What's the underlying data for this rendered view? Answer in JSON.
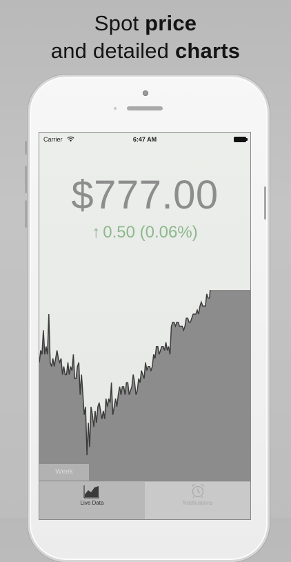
{
  "headline": {
    "line1_prefix": "Spot ",
    "line1_bold": "price",
    "line2_prefix": "and detailed ",
    "line2_bold": "charts"
  },
  "status_bar": {
    "carrier": "Carrier",
    "time": "6:47 AM"
  },
  "price": {
    "value": "$777.00",
    "change": "0.50 (0.06%)",
    "direction_icon": "up-arrow-icon",
    "change_color": "#8cb88c"
  },
  "chart_range_tab": "Week",
  "tab_bar": {
    "tabs": [
      {
        "label": "Live Data",
        "icon": "chart-icon",
        "active": true
      },
      {
        "label": "Notifications",
        "icon": "alarm-clock-icon",
        "active": false
      }
    ]
  },
  "chart_data": {
    "type": "area",
    "y": [
      738,
      741,
      740,
      746,
      740,
      742,
      740,
      750,
      738,
      737,
      739,
      737,
      739,
      741,
      739,
      738,
      739,
      735,
      737,
      735,
      735,
      738,
      735,
      737,
      736,
      740,
      734,
      734,
      737,
      738,
      730,
      735,
      730,
      725,
      727,
      715,
      723,
      717,
      727,
      725,
      722,
      726,
      723,
      727,
      728,
      726,
      724,
      726,
      724,
      729,
      727,
      729,
      728,
      733,
      725,
      727,
      729,
      727,
      730,
      732,
      730,
      732,
      732,
      730,
      733,
      733,
      730,
      731,
      732,
      735,
      733,
      730,
      731,
      734,
      733,
      736,
      735,
      734,
      738,
      736,
      737,
      737,
      736,
      737,
      740,
      739,
      742,
      742,
      740,
      741,
      742,
      742,
      741,
      743,
      741,
      742,
      740,
      747,
      748,
      748,
      747,
      748,
      748,
      747,
      747,
      747,
      746,
      747,
      749,
      749,
      748,
      748,
      749,
      750,
      750,
      750,
      751,
      750,
      752,
      753,
      752,
      752,
      752,
      755,
      754,
      754,
      758,
      758,
      758,
      762,
      764,
      763,
      763,
      763,
      763,
      763,
      765,
      764,
      763,
      765,
      763,
      764,
      763,
      764,
      765,
      765,
      766,
      767,
      766,
      765,
      766,
      764,
      766,
      768,
      769,
      768
    ],
    "ylim": [
      708,
      756
    ],
    "colors": {
      "fill": "#8c8c8c",
      "line": "#3c3c3c"
    }
  }
}
